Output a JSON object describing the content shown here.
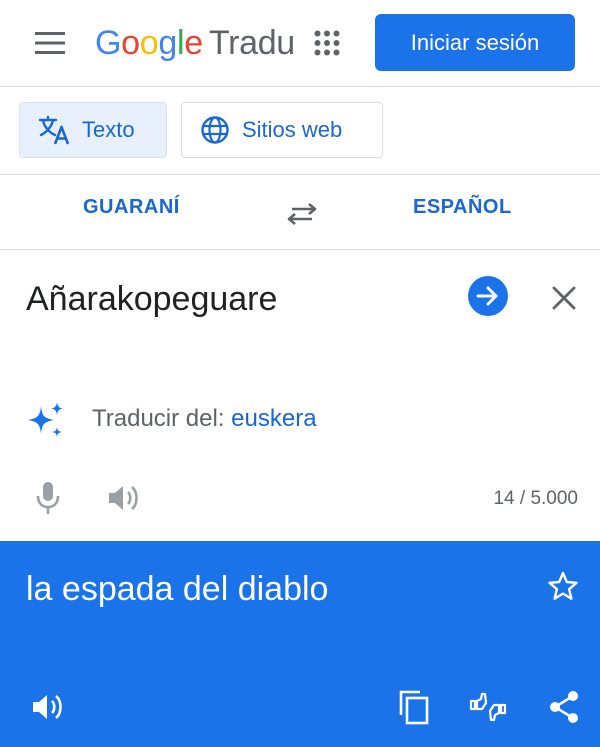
{
  "header": {
    "logo": {
      "G": "G",
      "o1": "o",
      "o2": "o",
      "g": "g",
      "l": "l",
      "e": "e"
    },
    "product_name": "Tradu",
    "signin_label": "Iniciar sesión",
    "icons": {
      "menu": "hamburger-menu-icon",
      "apps": "apps-grid-icon"
    }
  },
  "modes": [
    {
      "label": "Texto",
      "icon": "translate-icon",
      "active": true
    },
    {
      "label": "Sitios web",
      "icon": "globe-icon",
      "active": false
    }
  ],
  "languages": {
    "source": "GUARANÍ",
    "target": "ESPAÑOL",
    "swap_icon": "swap-arrows-icon"
  },
  "input": {
    "text": "Añarakopeguare",
    "detect_prefix": "Traducir del: ",
    "detect_language": "euskera",
    "char_count": "14 / 5.000"
  },
  "output": {
    "text": "la espada del diablo"
  },
  "colors": {
    "accent": "#1a73e8",
    "link": "#1967d2",
    "tab_active_bg": "#e8f0fe",
    "text_primary": "#202124",
    "text_secondary": "#5f6368",
    "divider": "#dadce0"
  }
}
